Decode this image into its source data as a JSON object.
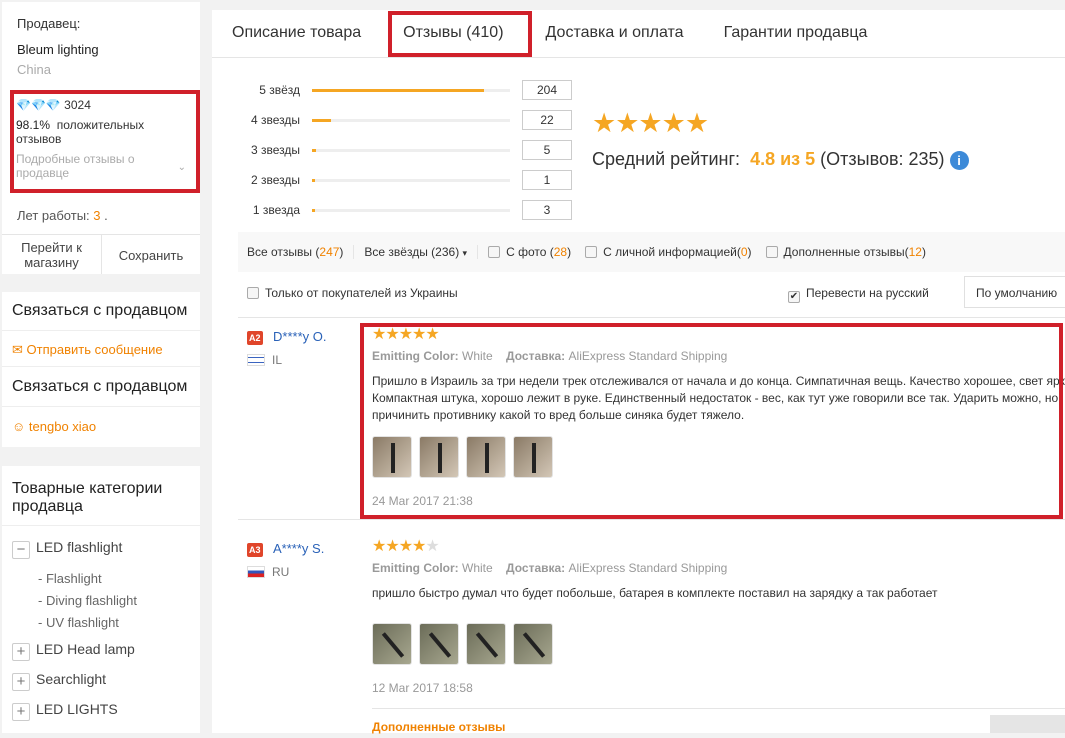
{
  "seller": {
    "label": "Продавец:",
    "name": "Bleum lighting",
    "country": "China",
    "score": "3024",
    "positive_pct": "98.1%",
    "positive_label": "положительных отзывов",
    "details": "Подробные отзывы о продавце",
    "years_label": "Лет работы:",
    "years": "3",
    "years_suffix": " .",
    "goto_store": "Перейти к магазину",
    "save": "Сохранить"
  },
  "contact": {
    "title": "Связаться с продавцом",
    "send_message": "Отправить сообщение",
    "title2": "Связаться с продавцом",
    "agent": "tengbo xiao"
  },
  "categories": {
    "title": "Товарные категории продавца",
    "items": [
      {
        "label": "LED flashlight",
        "expanded": true,
        "sub": [
          "- Flashlight",
          "- Diving flashlight",
          "- UV flashlight"
        ]
      },
      {
        "label": "LED Head lamp"
      },
      {
        "label": "Searchlight"
      },
      {
        "label": "LED LIGHTS"
      }
    ]
  },
  "tabs": [
    "Описание товара",
    "Отзывы (410)",
    "Доставка и оплата",
    "Гарантии продавца"
  ],
  "active_tab": 1,
  "ratings": {
    "rows": [
      {
        "label": "5 звёзд",
        "count": "204",
        "fraction": 0.868
      },
      {
        "label": "4 звезды",
        "count": "22",
        "fraction": 0.094
      },
      {
        "label": "3 звезды",
        "count": "5",
        "fraction": 0.021
      },
      {
        "label": "2 звезды",
        "count": "1",
        "fraction": 0.004
      },
      {
        "label": "1 звезда",
        "count": "3",
        "fraction": 0.013
      }
    ],
    "avg_label": "Средний рейтинг:",
    "avg": "4.8 из 5",
    "total": "(Отзывов: 235)",
    "accent": "#f5a623"
  },
  "filters": {
    "all": "Все отзывы",
    "all_count": "247",
    "stars": "Все звёзды (236)",
    "photo": "С фото",
    "photo_count": "28",
    "personal": "С личной информацией",
    "personal_count": "0",
    "added": "Дополненные отзывы",
    "added_count": "12",
    "ukraine": "Только от покупателей из Украины",
    "translate": "Перевести на русский",
    "translate_checked": true,
    "sort": "По умолчанию"
  },
  "reviews": [
    {
      "badge": "A2",
      "user": "D****y O.",
      "country": "IL",
      "stars": 5,
      "attr_label": "Emitting Color:",
      "attr": "White",
      "ship_label": "Доставка:",
      "ship": "AliExpress Standard Shipping",
      "text": "Пришло в Израиль за три недели трек отслеживался от начала и до конца. Симпатичная вещь. Качество хорошее, свет яркий. Компактная штука, хорошо лежит в руке. Единственный недостаток - вес, как тут уже говорили все так. Ударить можно, но причинить противнику какой то вред больше синяка будет тяжело.",
      "photos": 4,
      "date": "24 Mar 2017 21:38"
    },
    {
      "badge": "A3",
      "user": "A****y S.",
      "country": "RU",
      "stars": 4,
      "attr_label": "Emitting Color:",
      "attr": "White",
      "ship_label": "Доставка:",
      "ship": "AliExpress Standard Shipping",
      "text": "пришло быстро думал что будет побольше, батарея в комплекте поставил на зарядку а так работает",
      "photos": 4,
      "date": "12 Mar 2017 18:58",
      "added": "Дополненные отзывы"
    }
  ]
}
